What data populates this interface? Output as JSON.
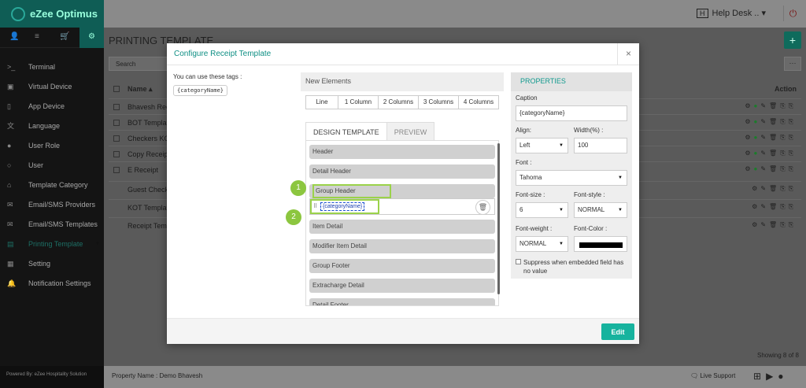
{
  "app": {
    "brand": "eZee Optimus",
    "helpdesk_badge": "H",
    "helpdesk_label": "Help Desk ..",
    "page_title": "PRINTING TEMPLATE",
    "search_placeholder": "Search",
    "add_label": "+",
    "more_label": "···"
  },
  "sidebar": {
    "items": [
      {
        "label": "Terminal",
        "icon": "terminal-icon"
      },
      {
        "label": "Virtual Device",
        "icon": "virtual-device-icon"
      },
      {
        "label": "App Device",
        "icon": "app-device-icon"
      },
      {
        "label": "Language",
        "icon": "language-icon"
      },
      {
        "label": "User Role",
        "icon": "user-role-icon"
      },
      {
        "label": "User",
        "icon": "user-icon"
      },
      {
        "label": "Template Category",
        "icon": "template-category-icon"
      },
      {
        "label": "Email/SMS Providers",
        "icon": "email-icon"
      },
      {
        "label": "Email/SMS Templates",
        "icon": "email-templates-icon"
      },
      {
        "label": "Printing Template",
        "icon": "printing-template-icon"
      },
      {
        "label": "Setting",
        "icon": "setting-icon"
      },
      {
        "label": "Notification Settings",
        "icon": "bell-icon"
      }
    ],
    "powered_by": "Powered By: eZee Hospitality Solution"
  },
  "table": {
    "col_name": "Name",
    "col_action": "Action",
    "rows": [
      "Bhavesh Rec",
      "BOT Templat",
      "Checkers KO",
      "Copy Receipt",
      "E Receipt",
      "Guest Check",
      "KOT Templat",
      "Receipt Temp"
    ],
    "showing": "Showing 8 of 8"
  },
  "footer": {
    "property": "Property Name : Demo Bhavesh",
    "live_support": "Live Support"
  },
  "modal": {
    "title": "Configure Receipt Template",
    "close": "×",
    "tags_label": "You can use these tags :",
    "tag": "{categoryName}",
    "new_elements": "New Elements",
    "columns": [
      "Line",
      "1 Column",
      "2 Columns",
      "3 Columns",
      "4 Columns"
    ],
    "tabs": {
      "design": "DESIGN TEMPLATE",
      "preview": "PREVIEW"
    },
    "blocks": {
      "header": "Header",
      "detail_header": "Detail Header",
      "group_header": "Group Header",
      "category_field": "{categoryName}",
      "item_detail": "Item Detail",
      "modifier_item_detail": "Modifier Item Detail",
      "group_footer": "Group Footer",
      "extracharge_detail": "Extracharge Detail",
      "detail_footer": "Detail Footer"
    },
    "badges": [
      "1",
      "2"
    ],
    "edit_label": "Edit",
    "properties": {
      "title": "PROPERTIES",
      "caption_label": "Caption",
      "caption_value": "{categoryName}",
      "align_label": "Align:",
      "align_value": "Left",
      "width_label": "Width(%) :",
      "width_value": "100",
      "font_label": "Font :",
      "font_value": "Tahoma",
      "fontsize_label": "Font-size :",
      "fontsize_value": "6",
      "fontstyle_label": "Font-style :",
      "fontstyle_value": "NORMAL",
      "fontweight_label": "Font-weight :",
      "fontweight_value": "NORMAL",
      "fontcolor_label": "Font-Color :",
      "fontcolor_value": "#000000",
      "suppress_label": "Suppress when embedded field has no value"
    }
  },
  "colors": {
    "accent": "#17b39e",
    "highlight": "#9bd24a",
    "brand_dark": "#0f5d55"
  }
}
